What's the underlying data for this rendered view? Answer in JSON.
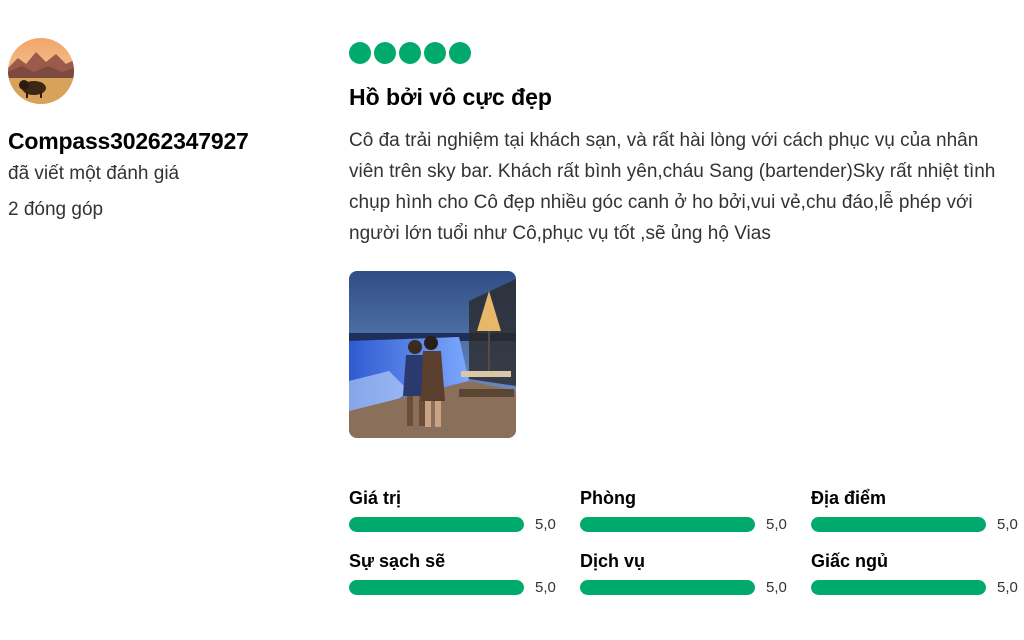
{
  "reviewer": {
    "avatar_icon": "bison-landscape-avatar",
    "username": "Compass30262347927",
    "action_text": "đã viết một đánh giá",
    "contributions": "2 đóng góp"
  },
  "review": {
    "rating": 5,
    "rating_max": 5,
    "bubble_color": "#00aa6c",
    "title": "Hồ bởi vô cực đẹp",
    "body": "Cô đa trải nghiệm tại khách sạn, và rất hài lòng với cách phục vụ của nhân viên trên sky bar. Khách rất bình yên,cháu Sang (bartender)Sky rất nhiệt tình chụp hình cho Cô đẹp nhiều góc canh ở ho bởi,vui vẻ,chu đáo,lễ phép với người lớn tuổi như Cô,phục vụ tốt ,sẽ ủng hộ Vias",
    "photo_icon": "rooftop-pool-photo"
  },
  "sub_ratings": [
    {
      "label": "Giá trị",
      "value": "5,0",
      "fraction": 1.0
    },
    {
      "label": "Phòng",
      "value": "5,0",
      "fraction": 1.0
    },
    {
      "label": "Địa điểm",
      "value": "5,0",
      "fraction": 1.0
    },
    {
      "label": "Sự sạch sẽ",
      "value": "5,0",
      "fraction": 1.0
    },
    {
      "label": "Dịch vụ",
      "value": "5,0",
      "fraction": 1.0
    },
    {
      "label": "Giấc ngủ",
      "value": "5,0",
      "fraction": 1.0
    }
  ]
}
